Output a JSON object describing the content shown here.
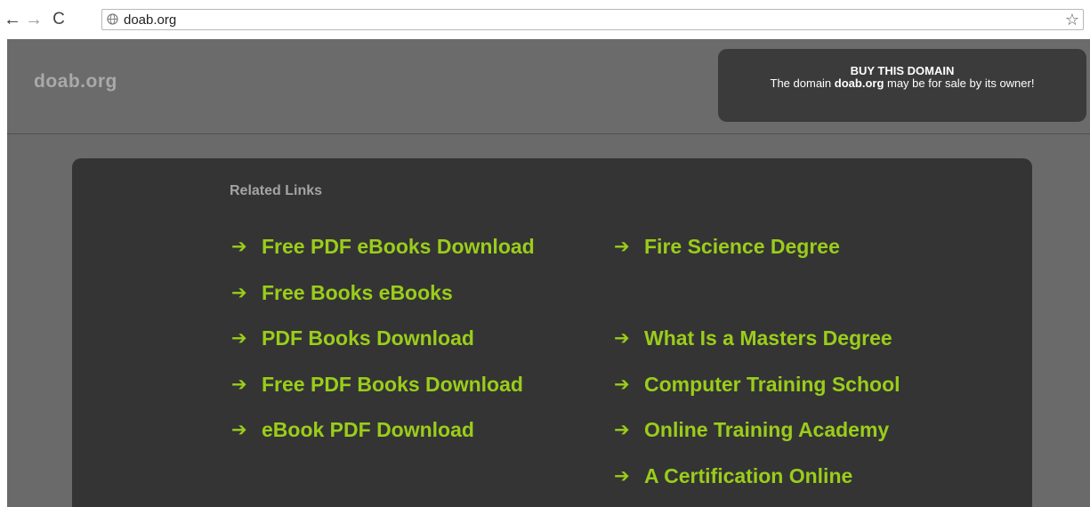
{
  "browser": {
    "url": "doab.org",
    "back_glyph": "←",
    "forward_glyph": "→",
    "reload_glyph": "C",
    "star_glyph": "☆"
  },
  "header": {
    "site_title": "doab.org",
    "buy_box": {
      "title": "BUY THIS DOMAIN",
      "text_prefix": "The domain ",
      "domain": "doab.org",
      "text_suffix": " may be for sale by its owner!"
    }
  },
  "related": {
    "heading": "Related Links",
    "arrow_glyph": "➔",
    "left_links": [
      "Free PDF eBooks Download",
      "Free Books eBooks",
      "PDF Books Download",
      "Free PDF Books Download",
      "eBook PDF Download"
    ],
    "right_links": [
      "Fire Science Degree",
      "What Is a Masters Degree",
      "Computer Training School",
      "Online Training Academy",
      "A Certification Online"
    ]
  },
  "colors": {
    "page_bg": "#6a6a6a",
    "box_bg": "#343434",
    "link_green": "#9acd1a",
    "heading_gray": "#a4a4a4"
  }
}
